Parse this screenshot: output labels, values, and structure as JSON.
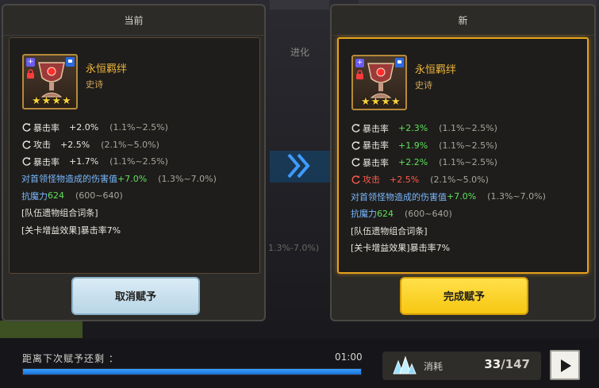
{
  "background": {
    "evolve_tab": "进化",
    "ghost_range": "1.3%-7.0%)"
  },
  "current_panel": {
    "title": "当前",
    "relic": {
      "name": "永恒羁绊",
      "rarity": "史诗",
      "stars": 4,
      "badge": "+",
      "name_color": "#f0b63c"
    },
    "stats": [
      {
        "name": "暴击率",
        "value": "+2.0%",
        "range": "(1.1%~2.5%)",
        "value_color": "white"
      },
      {
        "name": "攻击",
        "value": "+2.5%",
        "range": "(2.1%~5.0%)",
        "value_color": "white"
      },
      {
        "name": "暴击率",
        "value": "+1.7%",
        "range": "(1.1%~2.5%)",
        "value_color": "white"
      }
    ],
    "boss_damage": {
      "label": "对首领怪物造成的伤害值",
      "value": "+7.0%",
      "range": "(1.3%~7.0%)"
    },
    "magic_resist": {
      "label": "抗魔力",
      "value": "624",
      "range": "(600~640)"
    },
    "team_combo": "[队伍遗物组合词条]",
    "stage_buff": "[关卡增益效果]暴击率7%",
    "button": "取消赋予"
  },
  "new_panel": {
    "title": "新",
    "relic": {
      "name": "永恒羁绊",
      "rarity": "史诗",
      "stars": 4,
      "badge": "+"
    },
    "stats": [
      {
        "name": "暴击率",
        "value": "+2.3%",
        "range": "(1.1%~2.5%)",
        "value_color": "green"
      },
      {
        "name": "暴击率",
        "value": "+1.9%",
        "range": "(1.1%~2.5%)",
        "value_color": "green"
      },
      {
        "name": "暴击率",
        "value": "+2.2%",
        "range": "(1.1%~2.5%)",
        "value_color": "green"
      },
      {
        "name": "攻击",
        "value": "+2.5%",
        "range": "(2.1%~5.0%)",
        "value_color": "red"
      }
    ],
    "boss_damage": {
      "label": "对首领怪物造成的伤害值",
      "value": "+7.0%",
      "range": "(1.3%~7.0%)"
    },
    "magic_resist": {
      "label": "抗魔力",
      "value": "624",
      "range": "(600~640)"
    },
    "team_combo": "[队伍遗物组合词条]",
    "stage_buff": "[关卡增益效果]暴击率7%",
    "button": "完成赋予"
  },
  "bottom": {
    "timer_label": "距离下次赋予还剩 ：",
    "timer_value": "01:00",
    "timer_progress": 1.0,
    "cost_label": "消耗",
    "cost_current": "33",
    "cost_max": "/147"
  },
  "colors": {
    "accent_gold": "#e6a21c",
    "stat_green": "#5fe05a",
    "stat_red": "#ff5a4c",
    "stat_blue": "#7ab8ff",
    "progress_blue": "#2a8cf0"
  },
  "icons": [
    "chalice-icon",
    "lock-icon",
    "flag-icon",
    "refresh-icon",
    "double-chevron-right-icon",
    "crystal-cluster-icon",
    "play-icon",
    "star-icon"
  ]
}
